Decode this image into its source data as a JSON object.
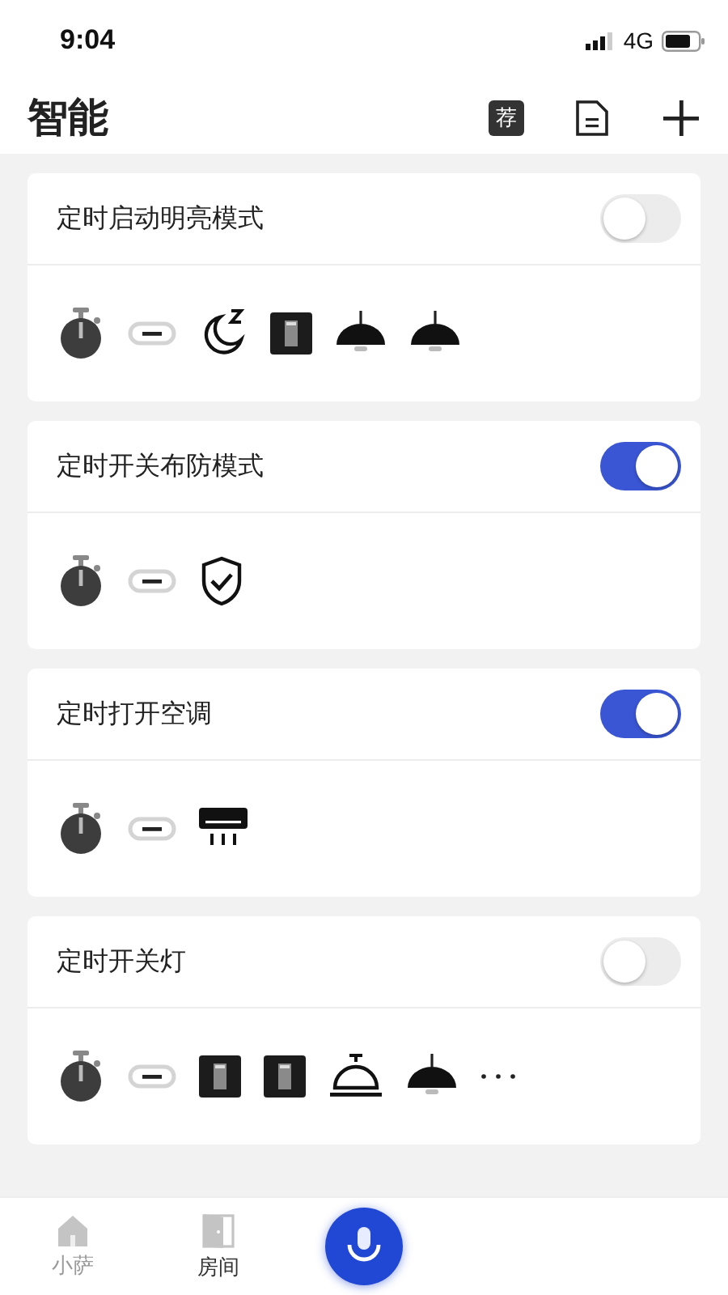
{
  "status_bar": {
    "time": "9:04",
    "network": "4G"
  },
  "header": {
    "title": "智能",
    "badge": "荐"
  },
  "scenes": [
    {
      "title": "定时启动明亮模式",
      "on": false,
      "icons": [
        {
          "kind": "timer"
        },
        {
          "kind": "link"
        },
        {
          "kind": "moon"
        },
        {
          "kind": "switch"
        },
        {
          "kind": "lamp"
        },
        {
          "kind": "lamp"
        }
      ]
    },
    {
      "title": "定时开关布防模式",
      "on": true,
      "icons": [
        {
          "kind": "timer"
        },
        {
          "kind": "link"
        },
        {
          "kind": "shield"
        }
      ]
    },
    {
      "title": "定时打开空调",
      "on": true,
      "icons": [
        {
          "kind": "timer"
        },
        {
          "kind": "link"
        },
        {
          "kind": "aircon"
        }
      ]
    },
    {
      "title": "定时开关灯",
      "on": false,
      "icons": [
        {
          "kind": "timer"
        },
        {
          "kind": "link"
        },
        {
          "kind": "switch"
        },
        {
          "kind": "switch"
        },
        {
          "kind": "bell"
        },
        {
          "kind": "lamp"
        },
        {
          "kind": "more"
        }
      ]
    }
  ],
  "tab_bar": [
    {
      "kind": "home",
      "label": "小萨",
      "selected": false
    },
    {
      "kind": "room",
      "label": "房间",
      "selected": true
    },
    {
      "kind": "mic"
    }
  ]
}
